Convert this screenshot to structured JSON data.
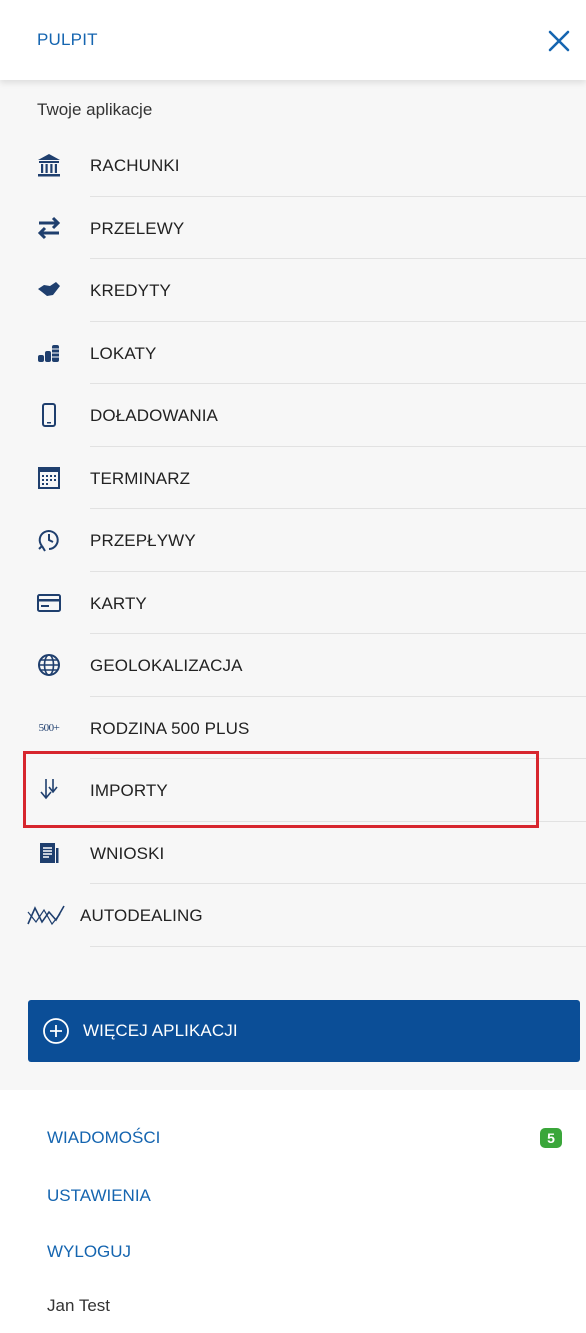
{
  "header": {
    "title": "PULPIT"
  },
  "apps": {
    "heading": "Twoje aplikacje",
    "items": [
      {
        "label": "RACHUNKI",
        "icon": "bank-icon"
      },
      {
        "label": "PRZELEWY",
        "icon": "transfer-arrows-icon"
      },
      {
        "label": "KREDYTY",
        "icon": "handshake-icon"
      },
      {
        "label": "LOKATY",
        "icon": "coins-icon"
      },
      {
        "label": "DOŁADOWANIA",
        "icon": "phone-icon"
      },
      {
        "label": "TERMINARZ",
        "icon": "calendar-icon"
      },
      {
        "label": "PRZEPŁYWY",
        "icon": "clock-flow-icon"
      },
      {
        "label": "KARTY",
        "icon": "card-icon"
      },
      {
        "label": "GEOLOKALIZACJA",
        "icon": "globe-icon"
      },
      {
        "label": "RODZINA 500 PLUS",
        "icon": "500-plus-icon",
        "icon_text": "500+"
      },
      {
        "label": "IMPORTY",
        "icon": "import-arrows-icon"
      },
      {
        "label": "WNIOSKI",
        "icon": "document-icon"
      },
      {
        "label": "AUTODEALING",
        "icon": "chart-line-icon"
      }
    ],
    "more_button": "WIĘCEJ APLIKACJI"
  },
  "footer": {
    "messages": "WIADOMOŚCI",
    "messages_count": "5",
    "settings": "USTAWIENIA",
    "logout": "WYLOGUJ",
    "user": "Jan Test"
  },
  "colors": {
    "brand_blue": "#1565b0",
    "button_blue": "#0b4e97",
    "badge_green": "#3aa63a",
    "highlight_red": "#d7262e",
    "icon_navy": "#1f3f6e"
  }
}
